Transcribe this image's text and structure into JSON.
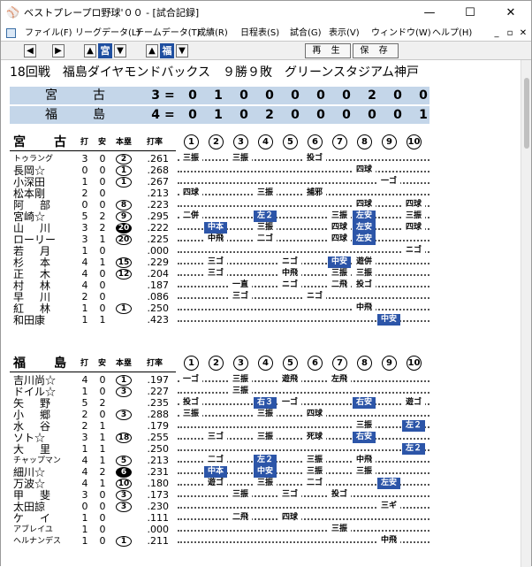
{
  "window": {
    "title": "ベストプレープロ野球'００ - [試合記録]",
    "controls": {
      "minimize": "—",
      "maximize": "☐",
      "close": "✕"
    }
  },
  "menu": {
    "items": [
      "ファイル(F)",
      "リーグデータ(L)",
      "チームデータ(T)",
      "成績(R)",
      "日程表(S)",
      "試合(G)",
      "表示(V)",
      "ウィンドウ(W)",
      "ヘルプ(H)"
    ],
    "mdi": [
      "_",
      "▫",
      "✕"
    ]
  },
  "toolbar": {
    "team1": "宮",
    "team2": "福",
    "play_label": "再 生",
    "save_label": "保 存"
  },
  "game": {
    "title": "18回戦　福島ダイヤモンドバックス　９勝９敗　グリーンスタジアム神戸"
  },
  "linescore": [
    {
      "team": "宮古",
      "total": "3",
      "eq": "=",
      "innings": [
        "0",
        "1",
        "0",
        "0",
        "0",
        "0",
        "0",
        "2",
        "0",
        "0"
      ]
    },
    {
      "team": "福島",
      "total": "4",
      "eq": "=",
      "innings": [
        "0",
        "1",
        "0",
        "2",
        "0",
        "0",
        "0",
        "0",
        "0",
        "1"
      ]
    }
  ],
  "headers": {
    "ab": "打",
    "h": "安",
    "hr": "本塁",
    "avg": "打率",
    "innings": [
      "1",
      "2",
      "3",
      "4",
      "5",
      "6",
      "7",
      "8",
      "9",
      "10"
    ]
  },
  "miyako": {
    "team": "宮古",
    "players": [
      {
        "name": "トゥラング",
        "ab": "3",
        "h": "0",
        "hr": "2",
        "hrs": "c",
        "avg": ".261",
        "res": [
          [
            "1",
            "三振",
            ""
          ],
          [
            "3",
            "三振",
            ""
          ],
          [
            "6",
            "投ゴ",
            ""
          ]
        ]
      },
      {
        "name": "長岡☆",
        "ab": "0",
        "h": "0",
        "hr": "1",
        "hrs": "c",
        "avg": ".268",
        "res": [
          [
            "8",
            "四球",
            ""
          ]
        ]
      },
      {
        "name": "小深田",
        "ab": "1",
        "h": "0",
        "hr": "1",
        "hrs": "c",
        "avg": ".267",
        "res": [
          [
            "9",
            "一ゴ",
            ""
          ]
        ]
      },
      {
        "name": "松本剛",
        "ab": "2",
        "h": "0",
        "hr": "",
        "hrs": "",
        "avg": ".213",
        "res": [
          [
            "1",
            "四球",
            ""
          ],
          [
            "4",
            "三振",
            ""
          ],
          [
            "6",
            "捕邪",
            ""
          ]
        ]
      },
      {
        "name": "阿　部",
        "ab": "0",
        "h": "0",
        "hr": "8",
        "hrs": "c",
        "avg": ".223",
        "res": [
          [
            "8",
            "四球",
            ""
          ],
          [
            "10",
            "四球",
            ""
          ]
        ]
      },
      {
        "name": "宮崎☆",
        "ab": "5",
        "h": "2",
        "hr": "9",
        "hrs": "c",
        "avg": ".295",
        "res": [
          [
            "1",
            "二併",
            ""
          ],
          [
            "4",
            "左２",
            "h"
          ],
          [
            "7",
            "三振",
            ""
          ],
          [
            "8",
            "左安",
            "h"
          ],
          [
            "10",
            "三振",
            ""
          ]
        ]
      },
      {
        "name": "山　川",
        "ab": "3",
        "h": "2",
        "hr": "20",
        "hrs": "b",
        "avg": ".222",
        "res": [
          [
            "2",
            "中本",
            "h"
          ],
          [
            "4",
            "三振",
            ""
          ],
          [
            "7",
            "四球",
            ""
          ],
          [
            "8",
            "左安",
            "h"
          ],
          [
            "10",
            "四球",
            ""
          ]
        ]
      },
      {
        "name": "ローリー",
        "ab": "3",
        "h": "1",
        "hr": "20",
        "hrs": "c",
        "avg": ".225",
        "res": [
          [
            "2",
            "中飛",
            ""
          ],
          [
            "4",
            "二ゴ",
            ""
          ],
          [
            "7",
            "四球",
            ""
          ],
          [
            "8",
            "左安",
            "h"
          ]
        ]
      },
      {
        "name": "若　月",
        "ab": "1",
        "h": "0",
        "hr": "",
        "hrs": "",
        "avg": ".000",
        "res": [
          [
            "10",
            "ニゴ",
            ""
          ]
        ]
      },
      {
        "name": "杉　本",
        "ab": "4",
        "h": "1",
        "hr": "15",
        "hrs": "c",
        "avg": ".229",
        "res": [
          [
            "2",
            "三ゴ",
            ""
          ],
          [
            "5",
            "ニゴ",
            ""
          ],
          [
            "7",
            "中安",
            "h"
          ],
          [
            "8",
            "遊併",
            ""
          ]
        ]
      },
      {
        "name": "正　木",
        "ab": "4",
        "h": "0",
        "hr": "12",
        "hrs": "c",
        "avg": ".204",
        "res": [
          [
            "2",
            "三ゴ",
            ""
          ],
          [
            "5",
            "中飛",
            ""
          ],
          [
            "7",
            "三振",
            ""
          ],
          [
            "8",
            "三振",
            ""
          ]
        ]
      },
      {
        "name": "村　林",
        "ab": "4",
        "h": "0",
        "hr": "",
        "hrs": "",
        "avg": ".187",
        "res": [
          [
            "3",
            "一直",
            ""
          ],
          [
            "5",
            "ニゴ",
            ""
          ],
          [
            "7",
            "二飛",
            ""
          ],
          [
            "8",
            "投ゴ",
            ""
          ]
        ]
      },
      {
        "name": "早　川",
        "ab": "2",
        "h": "0",
        "hr": "",
        "hrs": "",
        "avg": ".086",
        "res": [
          [
            "3",
            "三ゴ",
            ""
          ],
          [
            "6",
            "ニゴ",
            ""
          ]
        ]
      },
      {
        "name": "紅　林",
        "ab": "1",
        "h": "0",
        "hr": "1",
        "hrs": "c",
        "avg": ".250",
        "res": [
          [
            "8",
            "中飛",
            ""
          ]
        ]
      },
      {
        "name": "和田康",
        "ab": "1",
        "h": "1",
        "hr": "",
        "hrs": "",
        "avg": ".423",
        "res": [
          [
            "9",
            "中安",
            "h"
          ]
        ]
      }
    ]
  },
  "fukushima": {
    "team": "福島",
    "players": [
      {
        "name": "吉川尚☆",
        "ab": "4",
        "h": "0",
        "hr": "1",
        "hrs": "c",
        "avg": ".197",
        "res": [
          [
            "1",
            "一ゴ",
            ""
          ],
          [
            "3",
            "三振",
            ""
          ],
          [
            "5",
            "遊飛",
            ""
          ],
          [
            "7",
            "左飛",
            ""
          ]
        ]
      },
      {
        "name": "ドイル☆",
        "ab": "1",
        "h": "0",
        "hr": "3",
        "hrs": "c",
        "avg": ".227",
        "res": [
          [
            "3",
            "三振",
            ""
          ]
        ]
      },
      {
        "name": "矢　野",
        "ab": "5",
        "h": "2",
        "hr": "",
        "hrs": "",
        "avg": ".235",
        "res": [
          [
            "1",
            "投ゴ",
            ""
          ],
          [
            "4",
            "右３",
            "h"
          ],
          [
            "5",
            "一ゴ",
            ""
          ],
          [
            "8",
            "右安",
            "h"
          ],
          [
            "10",
            "遊ゴ",
            ""
          ]
        ]
      },
      {
        "name": "小　郷",
        "ab": "2",
        "h": "0",
        "hr": "3",
        "hrs": "c",
        "avg": ".288",
        "res": [
          [
            "1",
            "三振",
            ""
          ],
          [
            "4",
            "三振",
            ""
          ],
          [
            "6",
            "四球",
            ""
          ]
        ]
      },
      {
        "name": "水　谷",
        "ab": "2",
        "h": "1",
        "hr": "",
        "hrs": "",
        "avg": ".179",
        "res": [
          [
            "8",
            "三振",
            ""
          ],
          [
            "10",
            "左２",
            "h"
          ]
        ]
      },
      {
        "name": "ソト☆",
        "ab": "3",
        "h": "1",
        "hr": "18",
        "hrs": "c",
        "avg": ".255",
        "res": [
          [
            "2",
            "三ゴ",
            ""
          ],
          [
            "4",
            "三振",
            ""
          ],
          [
            "6",
            "死球",
            ""
          ],
          [
            "8",
            "右安",
            "h"
          ]
        ]
      },
      {
        "name": "大　里",
        "ab": "1",
        "h": "1",
        "hr": "",
        "hrs": "",
        "avg": ".250",
        "res": [
          [
            "10",
            "左２",
            "h"
          ]
        ]
      },
      {
        "name": "チャップマン",
        "ab": "4",
        "h": "1",
        "hr": "5",
        "hrs": "c",
        "avg": ".213",
        "res": [
          [
            "2",
            "二ゴ",
            ""
          ],
          [
            "4",
            "左２",
            "h"
          ],
          [
            "6",
            "三振",
            ""
          ],
          [
            "8",
            "中飛",
            ""
          ]
        ]
      },
      {
        "name": "細川☆",
        "ab": "4",
        "h": "2",
        "hr": "6",
        "hrs": "b",
        "avg": ".231",
        "res": [
          [
            "2",
            "中本",
            "h"
          ],
          [
            "4",
            "中安",
            "h"
          ],
          [
            "6",
            "三振",
            ""
          ],
          [
            "8",
            "三振",
            ""
          ]
        ]
      },
      {
        "name": "万波☆",
        "ab": "4",
        "h": "1",
        "hr": "10",
        "hrs": "c",
        "avg": ".180",
        "res": [
          [
            "2",
            "遊ゴ",
            ""
          ],
          [
            "4",
            "三振",
            ""
          ],
          [
            "6",
            "二ゴ",
            ""
          ],
          [
            "9",
            "左安",
            "h"
          ]
        ]
      },
      {
        "name": "甲　斐",
        "ab": "3",
        "h": "0",
        "hr": "3",
        "hrs": "c",
        "avg": ".173",
        "res": [
          [
            "3",
            "三振",
            ""
          ],
          [
            "5",
            "三ゴ",
            ""
          ],
          [
            "7",
            "投ゴ",
            ""
          ]
        ]
      },
      {
        "name": "太田諒",
        "ab": "0",
        "h": "0",
        "hr": "3",
        "hrs": "c",
        "avg": ".230",
        "res": [
          [
            "9",
            "三ギ",
            ""
          ]
        ]
      },
      {
        "name": "ケ　イ",
        "ab": "1",
        "h": "0",
        "hr": "",
        "hrs": "",
        "avg": ".111",
        "res": [
          [
            "3",
            "二飛",
            ""
          ],
          [
            "5",
            "四球",
            ""
          ]
        ]
      },
      {
        "name": "アブレイユ",
        "ab": "1",
        "h": "0",
        "hr": "",
        "hrs": "",
        "avg": ".000",
        "res": [
          [
            "7",
            "三振",
            ""
          ]
        ]
      },
      {
        "name": "ヘルナンデス",
        "ab": "1",
        "h": "0",
        "hr": "1",
        "hrs": "c",
        "avg": ".211",
        "res": [
          [
            "9",
            "中飛",
            ""
          ]
        ]
      }
    ]
  }
}
